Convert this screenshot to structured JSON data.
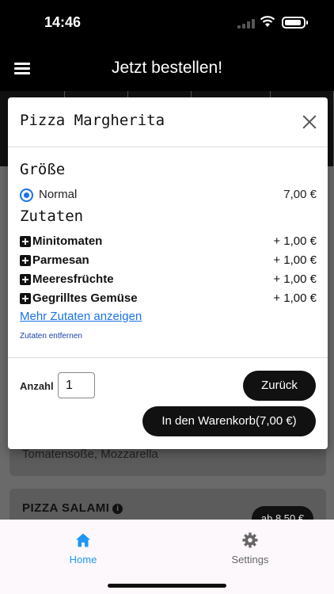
{
  "status_bar": {
    "time": "14:46"
  },
  "header": {
    "title": "Jetzt bestellen!"
  },
  "background": {
    "card1_desc": "Tomatensoße, Mozzarella",
    "card2_name": "PIZZA SALAMI",
    "card2_price": "ab 8,50 €"
  },
  "dialog": {
    "title": "Pizza Margherita",
    "size_heading": "Größe",
    "size_option": {
      "label": "Normal",
      "price": "7,00 €"
    },
    "toppings_heading": "Zutaten",
    "toppings": [
      {
        "name": "Minitomaten",
        "price": "+ 1,00 €"
      },
      {
        "name": "Parmesan",
        "price": "+ 1,00 €"
      },
      {
        "name": "Meeresfrüchte",
        "price": "+ 1,00 €"
      },
      {
        "name": "Gegrilltes Gemüse",
        "price": "+ 1,00 €"
      }
    ],
    "more_link": "Mehr Zutaten anzeigen",
    "remove_link": "Zutaten entfernen",
    "quantity_label": "Anzahl",
    "quantity_value": "1",
    "back_button": "Zurück",
    "cart_button": "In den Warenkorb(7,00 €)"
  },
  "bottom_nav": {
    "items": [
      {
        "label": "Home",
        "icon": "home-icon",
        "active": true
      },
      {
        "label": "Settings",
        "icon": "gear-icon",
        "active": false
      }
    ]
  },
  "colors": {
    "accent": "#1a73e8",
    "nav_active": "#2196f3",
    "nav_inactive": "#666666",
    "button_dark": "#111111"
  }
}
